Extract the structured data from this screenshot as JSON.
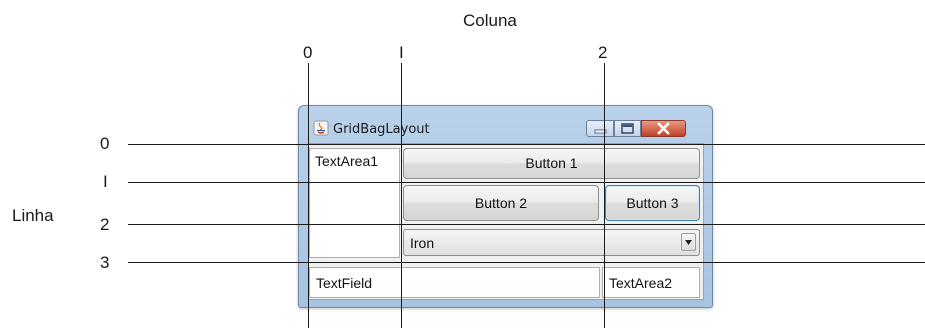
{
  "diagram": {
    "column_axis_label": "Coluna",
    "row_axis_label": "Linha",
    "column_numbers": [
      "0",
      "I",
      "2"
    ],
    "row_numbers": [
      "0",
      "I",
      "2",
      "3"
    ]
  },
  "window": {
    "title": "GridBagLayout",
    "controls": [
      "minimize",
      "maximize",
      "close"
    ]
  },
  "components": {
    "text_area_1": "TextArea1",
    "button_1": "Button 1",
    "button_2": "Button 2",
    "button_3": "Button 3",
    "combo_value": "Iron",
    "text_field": "TextField",
    "text_area_2": "TextArea2"
  },
  "icons": {
    "window_icon": "java-icon",
    "combo_arrow": "triangle-down-icon"
  },
  "colors": {
    "titlebar": "#b9d1ea",
    "close_button": "#c4412a",
    "focus_border": "#3c7fb1"
  }
}
